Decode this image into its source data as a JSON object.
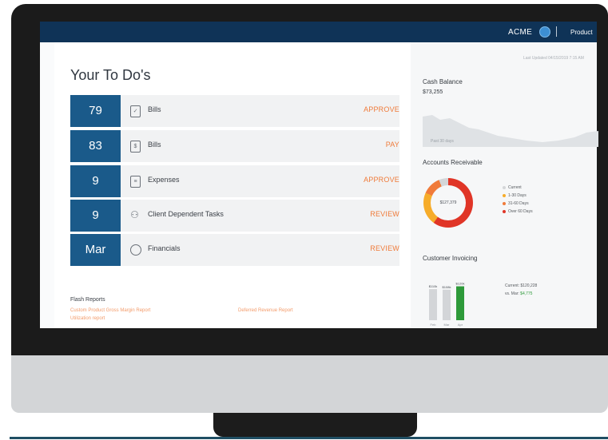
{
  "header": {
    "company": "ACME",
    "product": "Product"
  },
  "todo": {
    "title": "Your To Do's",
    "items": [
      {
        "count": "79",
        "icon": "document-icon",
        "label": "Bills",
        "action": "APPROVE"
      },
      {
        "count": "83",
        "icon": "bill-icon",
        "label": "Bills",
        "action": "PAY"
      },
      {
        "count": "9",
        "icon": "receipt-icon",
        "label": "Expenses",
        "action": "APPROVE"
      },
      {
        "count": "9",
        "icon": "person-icon",
        "label": "Client Dependent Tasks",
        "action": "REVIEW"
      },
      {
        "count": "Mar",
        "icon": "pie-icon",
        "label": "Financials",
        "action": "REVIEW"
      }
    ]
  },
  "flash_reports": {
    "title": "Flash Reports",
    "links": [
      "Custom Product Gross Margin Report",
      "Deferred Revenue Report",
      "Utilization report"
    ]
  },
  "dashboard": {
    "last_updated": "Last Updated 04/15/2019 7:15 AM",
    "cash_balance": {
      "title": "Cash Balance",
      "value": "$73,255",
      "footnote": "Past 30 days"
    },
    "accounts_receivable": {
      "title": "Accounts Receivable",
      "total": "$127,379",
      "segments": [
        {
          "label": "Current",
          "color": "#d4d6d8",
          "share": 0.06
        },
        {
          "label": "1-30 Days",
          "color": "#f6ac2a",
          "share": 0.22
        },
        {
          "label": "31-60 Days",
          "color": "#f07b3a",
          "share": 0.12
        },
        {
          "label": "Over 60 Days",
          "color": "#e03527",
          "share": 0.6
        }
      ]
    },
    "customer_invoicing": {
      "title": "Customer Invoicing",
      "current_label": "Current:",
      "current_value": "$120,228",
      "vs_label": "vs. Mar:",
      "vs_value": "$4,775"
    }
  },
  "chart_data": {
    "type": "bar",
    "categories": [
      "Feb",
      "Mar",
      "Apr"
    ],
    "values": [
      110,
      108,
      120
    ],
    "labels": [
      "$110k",
      "$108k",
      "$120k"
    ],
    "colors": [
      "#d3d5d8",
      "#d3d5d8",
      "#2e9a3a"
    ],
    "ylim": [
      0,
      130
    ]
  },
  "colors": {
    "nav": "#0f3357",
    "count_tile": "#1a5a8a",
    "action": "#f07b3a",
    "positive": "#2e9a3a"
  }
}
